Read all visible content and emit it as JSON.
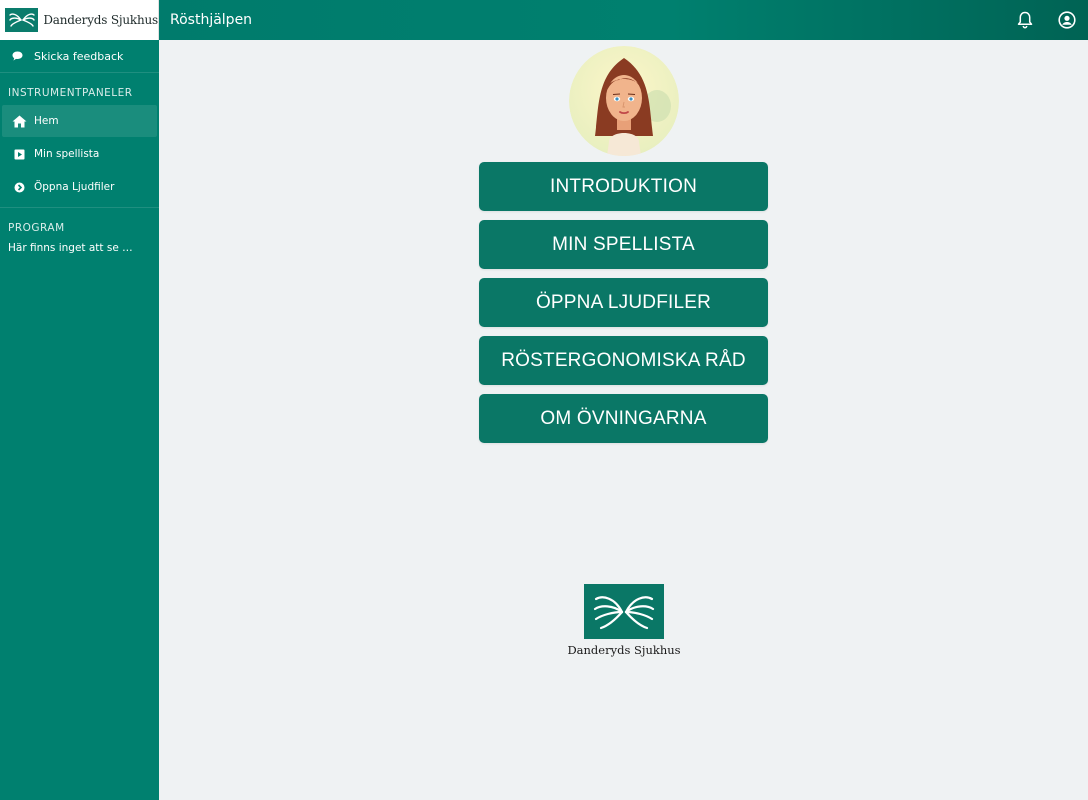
{
  "brand": {
    "name": "Danderyds Sjukhus",
    "logo_icon": "butterfly-hands-logo"
  },
  "app": {
    "title": "Rösthjälpen"
  },
  "topbar": {
    "icons": [
      "bell-icon",
      "account-circle-icon"
    ]
  },
  "sidebar": {
    "feedback_label": "Skicka feedback",
    "dashboards_heading": "INSTRUMENTPANELER",
    "items": [
      {
        "label": "Hem",
        "icon": "home-icon",
        "active": true
      },
      {
        "label": "Min spellista",
        "icon": "play-square-icon",
        "active": false
      },
      {
        "label": "Öppna Ljudfiler",
        "icon": "chevron-circle-icon",
        "active": false
      }
    ],
    "program_heading": "PROGRAM",
    "program_empty": "Här finns inget att se …"
  },
  "main": {
    "buttons": [
      "INTRODUKTION",
      "MIN SPELLISTA",
      "ÖPPNA LJUDFILER",
      "RÖSTERGONOMISKA RÅD",
      "OM ÖVNINGARNA"
    ],
    "footer_logo_text": "Danderyds Sjukhus"
  },
  "colors": {
    "primary": "#00806f",
    "button": "#0a7766",
    "background": "#eff2f3"
  }
}
